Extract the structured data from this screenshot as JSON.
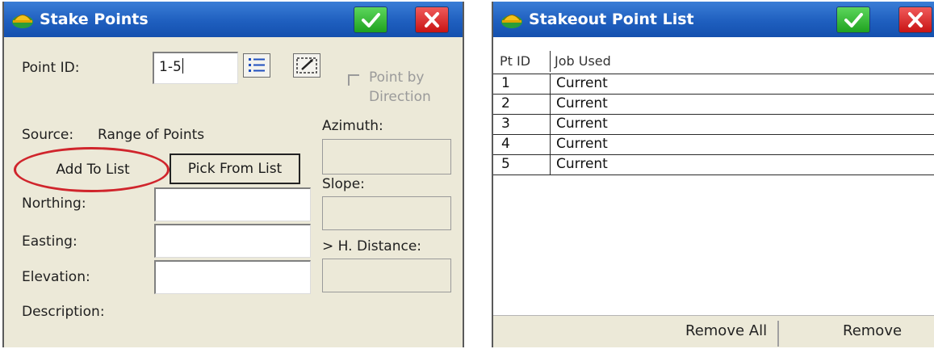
{
  "left": {
    "title": "Stake Points",
    "point_id_label": "Point ID:",
    "point_id_value": "1-5",
    "point_by_direction_label_1": "Point by",
    "point_by_direction_label_2": "Direction",
    "source_label": "Source:",
    "source_value": "Range of Points",
    "add_to_list_label": "Add To List",
    "pick_from_list_label": "Pick From List",
    "azimuth_label": "Azimuth:",
    "slope_label": "Slope:",
    "h_distance_label": "> H. Distance:",
    "northing_label": "Northing:",
    "easting_label": "Easting:",
    "elevation_label": "Elevation:",
    "description_label": "Description:",
    "northing_value": "",
    "easting_value": "",
    "elevation_value": ""
  },
  "right": {
    "title": "Stakeout Point List",
    "columns": [
      "Pt ID",
      "Job Used"
    ],
    "rows": [
      {
        "id": "1",
        "job": "Current"
      },
      {
        "id": "2",
        "job": "Current"
      },
      {
        "id": "3",
        "job": "Current"
      },
      {
        "id": "4",
        "job": "Current"
      },
      {
        "id": "5",
        "job": "Current"
      }
    ],
    "remove_all_label": "Remove All",
    "remove_label": "Remove"
  },
  "icons": {
    "app": "helmet-icon",
    "ok": "checkmark-icon",
    "cancel": "close-icon",
    "list": "list-icon",
    "map": "map-select-icon"
  },
  "colors": {
    "titlebar": "#1f5fbf",
    "ok_button": "#2fb52f",
    "cancel_button": "#d81e1e",
    "highlight_oval": "#d0252c",
    "dialog_bg": "#ece9d8"
  }
}
